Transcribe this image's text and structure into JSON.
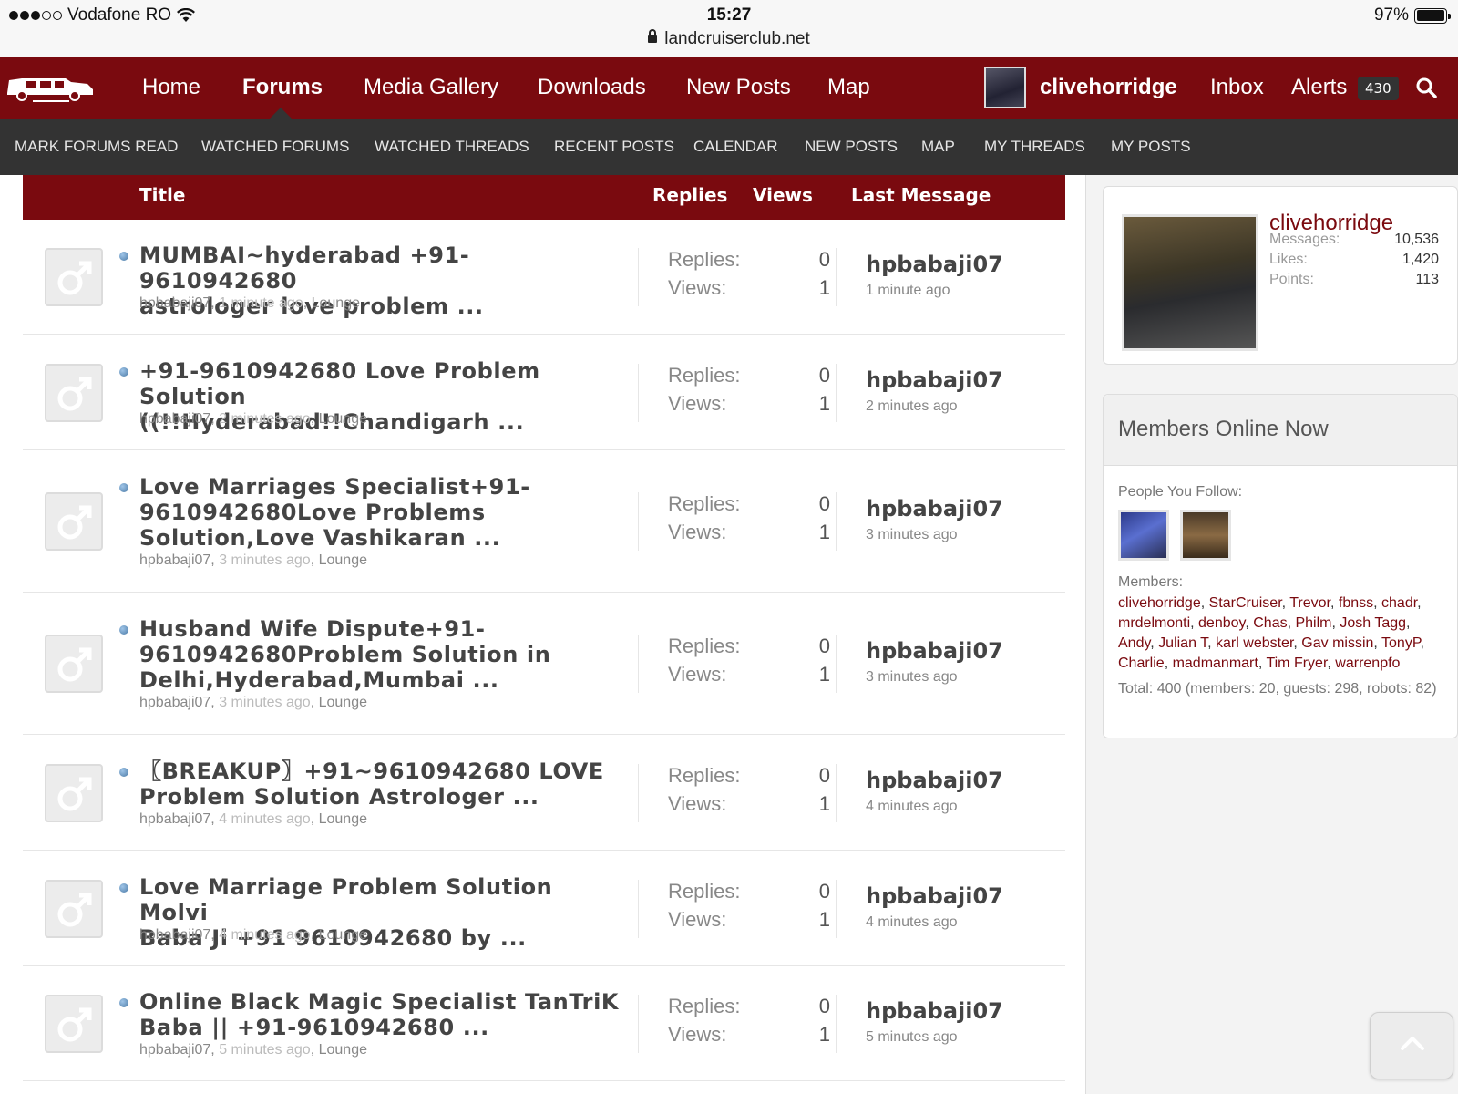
{
  "status_bar": {
    "carrier": "Vodafone RO",
    "time": "15:27",
    "url": "landcruiserclub.net",
    "battery": "97%",
    "battery_level": 0.97
  },
  "main_nav": {
    "items": [
      "Home",
      "Forums",
      "Media Gallery",
      "Downloads",
      "New Posts",
      "Map"
    ],
    "active": "Forums",
    "username": "clivehorridge",
    "inbox": "Inbox",
    "alerts": "Alerts",
    "alerts_count": "430",
    "accent_color": "#7a0a0f"
  },
  "sub_nav": {
    "items": [
      "MARK FORUMS READ",
      "WATCHED FORUMS",
      "WATCHED THREADS",
      "RECENT POSTS",
      "CALENDAR",
      "NEW POSTS",
      "MAP",
      "MY THREADS",
      "MY POSTS"
    ]
  },
  "table": {
    "headers": {
      "title": "Title",
      "replies": "Replies",
      "views": "Views",
      "last_message": "Last Message"
    },
    "replies_label": "Replies:",
    "views_label": "Views:",
    "threads": [
      {
        "title_lines": [
          "MUMBAI~hyderabad +91-9610942680",
          "astrologer love problem ..."
        ],
        "author": "hpbabaji07",
        "ago": "1 minute ago",
        "forum": "Lounge",
        "replies": "0",
        "views": "1",
        "last_user": "hpbabaji07",
        "last_time": "1 minute ago"
      },
      {
        "title_lines": [
          "+91-9610942680 Love Problem Solution",
          "((!!Hyderabad!!Chandigarh ..."
        ],
        "author": "hpbabaji07",
        "ago": "2 minutes ago",
        "forum": "Lounge",
        "replies": "0",
        "views": "1",
        "last_user": "hpbabaji07",
        "last_time": "2 minutes ago"
      },
      {
        "title_lines": [
          "Love Marriages Specialist+91-",
          "9610942680Love Problems",
          "Solution,Love Vashikaran ..."
        ],
        "author": "hpbabaji07",
        "ago": "3 minutes ago",
        "forum": "Lounge",
        "replies": "0",
        "views": "1",
        "last_user": "hpbabaji07",
        "last_time": "3 minutes ago"
      },
      {
        "title_lines": [
          "Husband Wife Dispute+91-",
          "9610942680Problem Solution in",
          "Delhi,Hyderabad,Mumbai ..."
        ],
        "author": "hpbabaji07",
        "ago": "3 minutes ago",
        "forum": "Lounge",
        "replies": "0",
        "views": "1",
        "last_user": "hpbabaji07",
        "last_time": "3 minutes ago"
      },
      {
        "title_lines": [
          "〖BREAKUP〗+91~9610942680 LOVE",
          "Problem Solution Astrologer ..."
        ],
        "author": "hpbabaji07",
        "ago": "4 minutes ago",
        "forum": "Lounge",
        "replies": "0",
        "views": "1",
        "last_user": "hpbabaji07",
        "last_time": "4 minutes ago"
      },
      {
        "title_lines": [
          "Love Marriage Problem Solution Molvi",
          "Baba Ji +91 9610942680 by ..."
        ],
        "author": "hpbabaji07",
        "ago": "4 minutes ago",
        "forum": "Lounge",
        "replies": "0",
        "views": "1",
        "last_user": "hpbabaji07",
        "last_time": "4 minutes ago"
      },
      {
        "title_lines": [
          "Online Black Magic Specialist TanTriK",
          "Baba || +91-9610942680 ..."
        ],
        "author": "hpbabaji07",
        "ago": "5 minutes ago",
        "forum": "Lounge",
        "replies": "0",
        "views": "1",
        "last_user": "hpbabaji07",
        "last_time": "5 minutes ago"
      }
    ]
  },
  "profile": {
    "name": "clivehorridge",
    "stats": [
      {
        "label": "Messages:",
        "value": "10,536"
      },
      {
        "label": "Likes:",
        "value": "1,420"
      },
      {
        "label": "Points:",
        "value": "113"
      }
    ]
  },
  "members_online": {
    "title": "Members Online Now",
    "follow_label": "People You Follow:",
    "members_label": "Members:",
    "members": [
      "clivehorridge",
      "StarCruiser",
      "Trevor",
      "fbnss",
      "chadr",
      "mrdelmonti",
      "denboy",
      "Chas",
      "Philm",
      "Josh Tagg",
      "Andy",
      "Julian T",
      "karl webster",
      "Gav missin",
      "TonyP",
      "Charlie",
      "madmanmart",
      "Tim Fryer",
      "warrenpfo"
    ],
    "total": "Total: 400 (members: 20, guests: 298, robots: 82)"
  }
}
